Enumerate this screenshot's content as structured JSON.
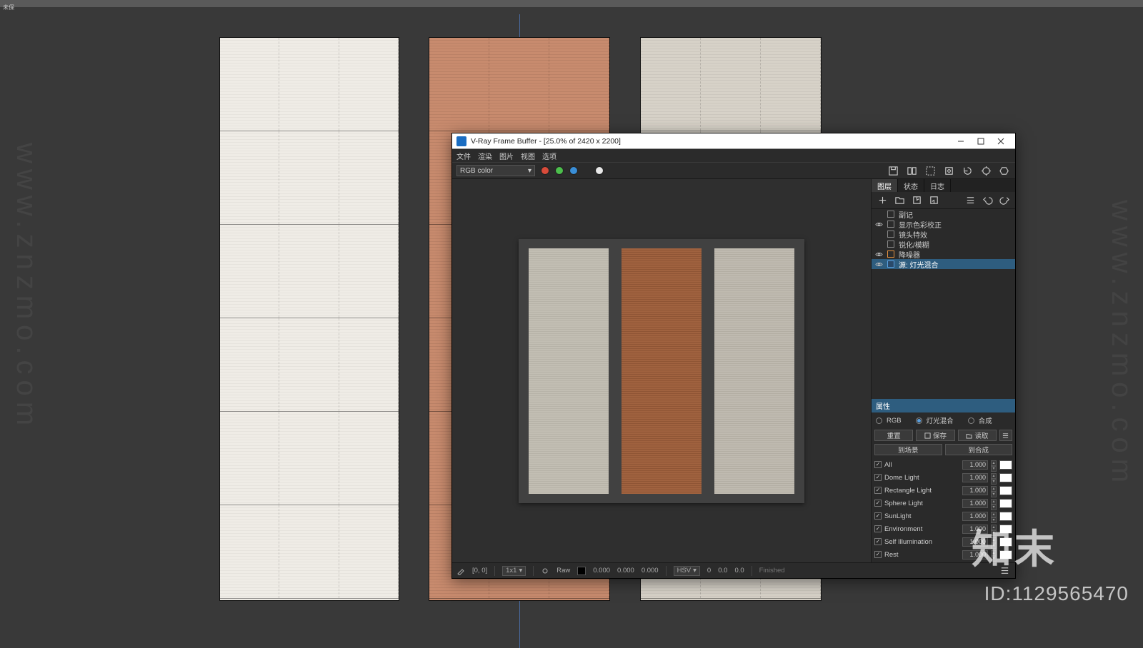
{
  "top_menu_hint": "未保",
  "vfb": {
    "title": "V-Ray Frame Buffer - [25.0% of 2420 x 2200]",
    "menu": [
      "文件",
      "渲染",
      "图片",
      "视图",
      "选项"
    ],
    "channel": "RGB color",
    "side_tabs": {
      "layers": "图层",
      "status": "状态",
      "log": "日志"
    },
    "layers": [
      {
        "name": "副记",
        "vis": false
      },
      {
        "name": "显示色彩校正",
        "vis": true
      },
      {
        "name": "镜头特效",
        "vis": false
      },
      {
        "name": "锐化/模糊",
        "vis": false
      },
      {
        "name": "降噪器",
        "vis": true
      },
      {
        "name": "源: 灯光混合",
        "vis": true,
        "sel": true
      }
    ],
    "props": {
      "header": "属性",
      "modes": {
        "rgb": "RGB",
        "lightmix": "灯光混合",
        "composite": "合成"
      },
      "buttons": {
        "reset": "重置",
        "save": "保存",
        "load": "读取"
      },
      "targets": {
        "scene": "到场景",
        "composite": "到合成"
      }
    },
    "lights": [
      {
        "name": "All",
        "val": "1.000"
      },
      {
        "name": "Dome Light",
        "val": "1.000"
      },
      {
        "name": "Rectangle Light",
        "val": "1.000"
      },
      {
        "name": "Sphere Light",
        "val": "1.000"
      },
      {
        "name": "SunLight",
        "val": "1.000"
      },
      {
        "name": "Environment",
        "val": "1.000"
      },
      {
        "name": "Self Illumination",
        "val": "1.000"
      },
      {
        "name": "Rest",
        "val": "1.000"
      }
    ],
    "status": {
      "coord": "[0, 0]",
      "zoom": "1x1",
      "raw_label": "Raw",
      "raw_vals": [
        "0.000",
        "0.000",
        "0.000"
      ],
      "hsv_label": "HSV",
      "hsv_vals": [
        "0",
        "0.0",
        "0.0"
      ],
      "state": "Finished"
    }
  },
  "watermark": {
    "brand": "知末",
    "id": "ID:1129565470",
    "url": "www.znzmo.com"
  }
}
